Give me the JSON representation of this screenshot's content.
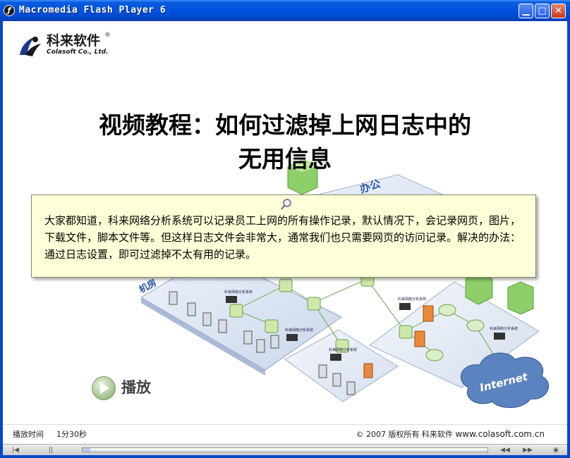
{
  "window": {
    "title": "Macromedia Flash Player 6",
    "icon": "flash-icon",
    "minimize_glyph": "▁",
    "maximize_glyph": "□",
    "close_glyph": "✕"
  },
  "logo": {
    "name_cn": "科来软件",
    "registered": "®",
    "name_en": "Colasoft Co., Ltd."
  },
  "title": {
    "line1": "视频教程：如何过滤掉上网日志中的",
    "line2": "无用信息"
  },
  "diagram": {
    "labels": {
      "office": "办公",
      "datacenter": "机房",
      "internet": "Internet",
      "analyzer1": "科来网络分析系统",
      "analyzer2": "科来网络分析系统",
      "analyzer3": "科来网络分析系统",
      "analyzer4": "科来网络分析系统",
      "analyzer5": "科来网络分析系统"
    }
  },
  "info": {
    "text": "大家都知道，科来网络分析系统可以记录员工上网的所有操作记录，默认情况下，会记录网页，图片，下载文件，脚本文件等。但这样日志文件会非常大，通常我们也只需要网页的访问记录。解决的办法：通过日志设置，即可过滤掉不太有用的记录。",
    "icon": "magnifier-icon"
  },
  "play": {
    "label": "播放"
  },
  "footer": {
    "time_label": "播放时间",
    "time_value": "1分30秒",
    "copyright": "© 2007 版权所有  科来软件  ",
    "url": "www.colasoft.com.cn"
  },
  "controller": {
    "rewind": "|◀",
    "pause": "||",
    "back": "◀◀",
    "forward": "▶▶",
    "options": "◉",
    "progress": 0.02
  },
  "colors": {
    "titlebar": "#0052e0",
    "infobox_bg": "#ffffd8",
    "accent_green": "#9fbf8a"
  }
}
